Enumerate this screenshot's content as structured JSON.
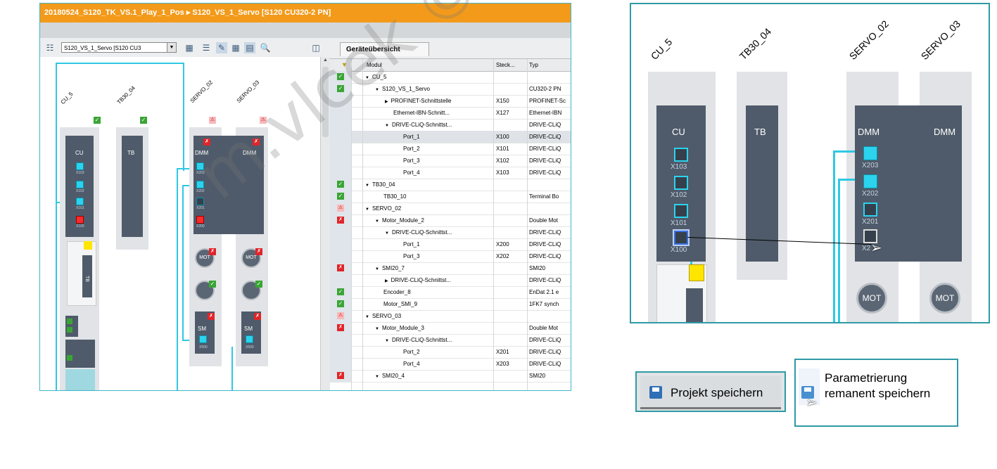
{
  "main_window": {
    "title": "20180524_S120_TK_VS.1_Play_1_Pos  ▸  S120_VS_1_Servo [S120 CU320-2 PN]",
    "device_select": "S120_VS_1_Servo [S120 CU3",
    "overview_tab": "Geräteübersicht",
    "table": {
      "headers": {
        "modul": "Modul",
        "steck": "Steck...",
        "typ": "Typ"
      },
      "rows": [
        {
          "indent": 1,
          "tri": "▼",
          "status": "ok",
          "modul": "CU_5",
          "steck": "",
          "typ": ""
        },
        {
          "indent": 2,
          "tri": "▼",
          "status": "ok",
          "modul": "S120_VS_1_Servo",
          "steck": "",
          "typ": "CU320-2 PN"
        },
        {
          "indent": 3,
          "tri": "▶",
          "status": "",
          "modul": "PROFINET-Schnittstelle",
          "steck": "X150",
          "typ": "PROFINET-Sc"
        },
        {
          "indent": 3,
          "tri": "",
          "status": "",
          "modul": "Ethernet-IBN-Schnitt...",
          "steck": "X127",
          "typ": "Ethernet-IBN"
        },
        {
          "indent": 3,
          "tri": "▼",
          "status": "",
          "modul": "DRIVE-CLiQ-Schnittst...",
          "steck": "",
          "typ": "DRIVE-CLiQ"
        },
        {
          "indent": 4,
          "tri": "",
          "status": "",
          "modul": "Port_1",
          "steck": "X100",
          "typ": "DRIVE-CLiQ",
          "selected": true
        },
        {
          "indent": 4,
          "tri": "",
          "status": "",
          "modul": "Port_2",
          "steck": "X101",
          "typ": "DRIVE-CLiQ"
        },
        {
          "indent": 4,
          "tri": "",
          "status": "",
          "modul": "Port_3",
          "steck": "X102",
          "typ": "DRIVE-CLiQ"
        },
        {
          "indent": 4,
          "tri": "",
          "status": "",
          "modul": "Port_4",
          "steck": "X103",
          "typ": "DRIVE-CLiQ"
        },
        {
          "indent": 1,
          "tri": "▼",
          "status": "ok",
          "modul": "TB30_04",
          "steck": "",
          "typ": ""
        },
        {
          "indent": 2,
          "tri": "",
          "status": "ok",
          "modul": "TB30_10",
          "steck": "",
          "typ": "Terminal Bo"
        },
        {
          "indent": 1,
          "tri": "▼",
          "status": "errlt",
          "modul": "SERVO_02",
          "steck": "",
          "typ": ""
        },
        {
          "indent": 2,
          "tri": "▼",
          "status": "err",
          "modul": "Motor_Module_2",
          "steck": "",
          "typ": "Double Mot"
        },
        {
          "indent": 3,
          "tri": "▼",
          "status": "",
          "modul": "DRIVE-CLiQ-Schnittst...",
          "steck": "",
          "typ": "DRIVE-CLiQ"
        },
        {
          "indent": 4,
          "tri": "",
          "status": "",
          "modul": "Port_1",
          "steck": "X200",
          "typ": "DRIVE-CLiQ"
        },
        {
          "indent": 4,
          "tri": "",
          "status": "",
          "modul": "Port_3",
          "steck": "X202",
          "typ": "DRIVE-CLiQ"
        },
        {
          "indent": 2,
          "tri": "▼",
          "status": "err",
          "modul": "SMI20_7",
          "steck": "",
          "typ": "SMI20"
        },
        {
          "indent": 3,
          "tri": "▶",
          "status": "",
          "modul": "DRIVE-CLiQ-Schnittst...",
          "steck": "",
          "typ": "DRIVE-CLiQ"
        },
        {
          "indent": 2,
          "tri": "",
          "status": "ok",
          "modul": "Encoder_8",
          "steck": "",
          "typ": "EnDat 2.1 e"
        },
        {
          "indent": 2,
          "tri": "",
          "status": "ok",
          "modul": "Motor_SMI_9",
          "steck": "",
          "typ": "1FK7 synch"
        },
        {
          "indent": 1,
          "tri": "▼",
          "status": "errlt",
          "modul": "SERVO_03",
          "steck": "",
          "typ": ""
        },
        {
          "indent": 2,
          "tri": "▼",
          "status": "err",
          "modul": "Motor_Module_3",
          "steck": "",
          "typ": "Double Mot"
        },
        {
          "indent": 3,
          "tri": "▼",
          "status": "",
          "modul": "DRIVE-CLiQ-Schnittst...",
          "steck": "",
          "typ": "DRIVE-CLiQ"
        },
        {
          "indent": 4,
          "tri": "",
          "status": "",
          "modul": "Port_2",
          "steck": "X201",
          "typ": "DRIVE-CLiQ"
        },
        {
          "indent": 4,
          "tri": "",
          "status": "",
          "modul": "Port_4",
          "steck": "X203",
          "typ": "DRIVE-CLiQ"
        },
        {
          "indent": 2,
          "tri": "▼",
          "status": "err",
          "modul": "SMI20_4",
          "steck": "",
          "typ": "SMI20"
        }
      ]
    },
    "canvas": {
      "labels": {
        "cu": "CU_5",
        "tb": "TB30_04",
        "servo2": "SERVO_02",
        "servo3": "SERVO_03"
      },
      "modules": {
        "cu": "CU",
        "tb": "TB",
        "dmm": "DMM",
        "mot": "MOT",
        "sm": "SM",
        "tb_side": "TB"
      },
      "ports": {
        "x103": "X103",
        "x102": "X102",
        "x101": "X101",
        "x100": "X100",
        "x203": "X203",
        "x202": "X202",
        "x201": "X201",
        "x200": "X200",
        "x500": "X500"
      }
    }
  },
  "zoom_panel": {
    "labels": {
      "cu": "CU_5",
      "tb": "TB30_04",
      "servo2": "SERVO_02",
      "servo3": "SERVO_03"
    },
    "modules": {
      "cu": "CU",
      "tb": "TB",
      "dmm1": "DMM",
      "dmm2": "DMM",
      "mot1": "MOT",
      "mot2": "MOT"
    },
    "ports": {
      "x103": "X103",
      "x102": "X102",
      "x101": "X101",
      "x100": "X100",
      "x203": "X203",
      "x202": "X202",
      "x201": "X201",
      "x200": "X2"
    }
  },
  "buttons": {
    "save_project": "Projekt speichern",
    "param_line1": "Parametrierung",
    "param_line2": "remanent speichern"
  },
  "watermark": "m.vlcek ©",
  "colors": {
    "accent": "#f39a1a",
    "cable": "#2fc8e4",
    "module": "#4f5b6a",
    "frame": "#2f9aa5"
  }
}
